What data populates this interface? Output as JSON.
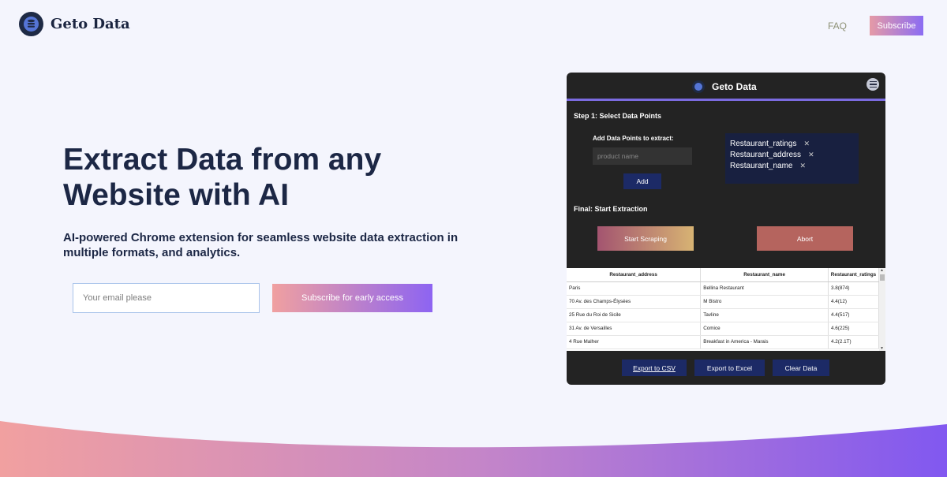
{
  "brand": {
    "name": "Geto Data"
  },
  "nav": {
    "faq": "FAQ",
    "subscribe": "Subscribe"
  },
  "hero": {
    "title": "Extract Data from any Website with AI",
    "subtitle": "AI-powered Chrome extension for seamless website data extraction in multiple formats, and analytics.",
    "email_placeholder": "Your email please",
    "cta": "Subscribe for early access"
  },
  "panel": {
    "title": "Geto Data",
    "step1": "Step 1: Select Data Points",
    "add_label": "Add Data Points to extract:",
    "input_placeholder": "product name",
    "add_button": "Add",
    "tags": [
      "Restaurant_ratings",
      "Restaurant_address",
      "Restaurant_name"
    ],
    "final": "Final: Start Extraction",
    "start_button": "Start Scraping",
    "abort_button": "Abort",
    "table": {
      "headers": [
        "Restaurant_address",
        "Restaurant_name",
        "Restaurant_ratings"
      ],
      "rows": [
        [
          "Paris",
          "Bellina Restaurant",
          "3.8(874)"
        ],
        [
          "70 Av. des Champs-Élysées",
          "M Bistro",
          "4.4(12)"
        ],
        [
          "25 Rue du Roi de Sicile",
          "Tavline",
          "4.4(517)"
        ],
        [
          "31 Av. de Versailles",
          "Comice",
          "4.6(225)"
        ],
        [
          "4 Rue Malher",
          "Breakfast in America - Marais",
          "4.2(2.1T)"
        ]
      ]
    },
    "export_csv": "Export to CSV",
    "export_excel": "Export to Excel",
    "clear": "Clear Data"
  },
  "colors": {
    "accent_purple": "#8b6cf3",
    "accent_pink": "#e59aa6",
    "navy": "#1c2745",
    "panel_bg": "#232323"
  },
  "icons": {
    "logo": "database-icon",
    "menu": "hamburger-icon"
  }
}
